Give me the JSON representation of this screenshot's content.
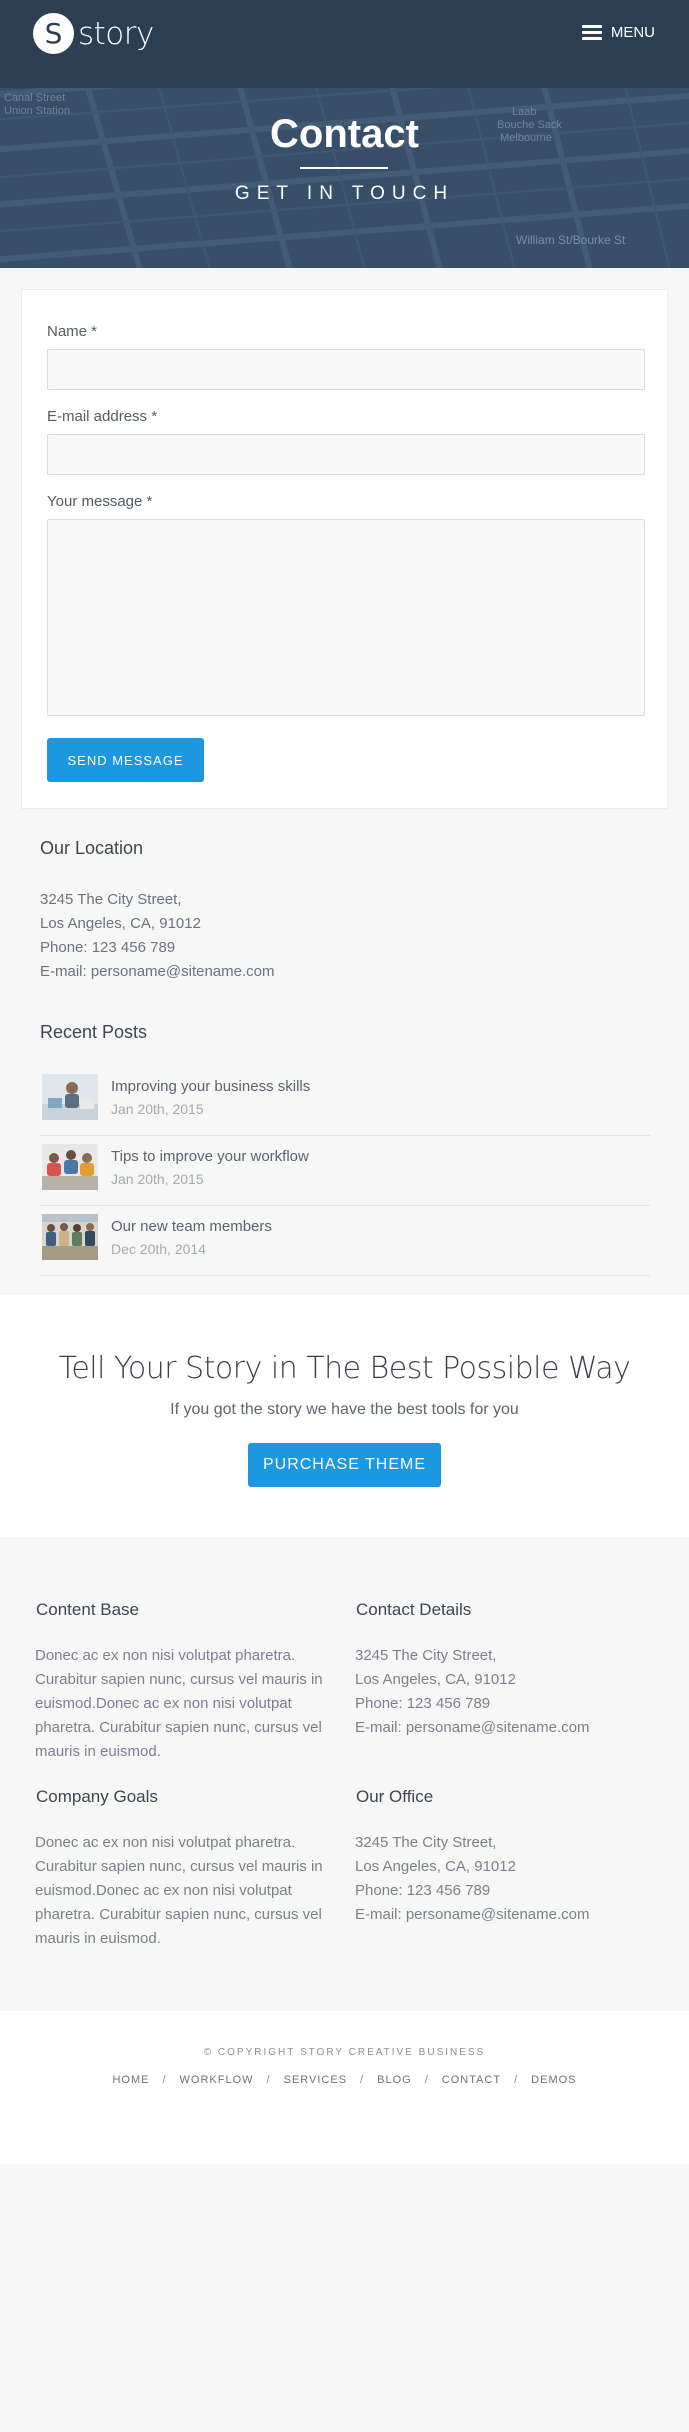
{
  "header": {
    "logo_letter": "S",
    "logo_text": "story",
    "menu_label": "MENU"
  },
  "hero": {
    "title": "Contact",
    "subtitle": "GET IN TOUCH",
    "map_labels": [
      "Canal Street",
      "Union Station",
      "Laab",
      "Bouche Sack",
      "Melbourne",
      "William St/Bourke St"
    ]
  },
  "form": {
    "name_label": "Name *",
    "name_value": "",
    "email_label": "E-mail address *",
    "email_value": "",
    "message_label": "Your message *",
    "message_value": "",
    "submit_label": "SEND MESSAGE"
  },
  "location": {
    "heading": "Our Location",
    "lines": [
      "3245 The City Street,",
      "Los Angeles, CA, 91012",
      "Phone: 123 456 789",
      "E-mail: personame@sitename.com"
    ]
  },
  "recent_posts": {
    "heading": "Recent Posts",
    "items": [
      {
        "title": "Improving your business skills",
        "date": "Jan 20th, 2015"
      },
      {
        "title": "Tips to improve your workflow",
        "date": "Jan 20th, 2015"
      },
      {
        "title": "Our new team members",
        "date": "Dec 20th, 2014"
      }
    ]
  },
  "cta": {
    "title": "Tell Your Story in The Best Possible Way",
    "subtitle": "If you got the story we have the best tools for you",
    "button_label": "PURCHASE THEME"
  },
  "info": {
    "content_base": {
      "heading": "Content Base",
      "lines": [
        "Donec ac ex non nisi volutpat pharetra.",
        "Curabitur sapien nunc, cursus vel mauris in",
        "euismod.Donec ac ex non nisi volutpat",
        "pharetra. Curabitur sapien nunc, cursus vel",
        "mauris in euismod."
      ]
    },
    "contact_details": {
      "heading": "Contact Details",
      "lines": [
        "3245 The City Street,",
        "Los Angeles, CA, 91012",
        "Phone: 123 456 789",
        "E-mail: personame@sitename.com"
      ]
    },
    "company_goals": {
      "heading": "Company Goals",
      "lines": [
        "Donec ac ex non nisi volutpat pharetra.",
        "Curabitur sapien nunc, cursus vel mauris in",
        "euismod.Donec ac ex non nisi volutpat",
        "pharetra. Curabitur sapien nunc, cursus vel",
        "mauris in euismod."
      ]
    },
    "our_office": {
      "heading": "Our Office",
      "lines": [
        "3245 The City Street,",
        "Los Angeles, CA, 91012",
        "Phone: 123 456 789",
        "E-mail: personame@sitename.com"
      ]
    }
  },
  "footer": {
    "copyright": "© COPYRIGHT STORY CREATIVE BUSINESS",
    "nav": [
      "HOME",
      "WORKFLOW",
      "SERVICES",
      "BLOG",
      "CONTACT",
      "DEMOS"
    ],
    "separator": "/"
  },
  "colors": {
    "accent": "#1b98e0",
    "header_bg": "#2c3e52",
    "page_bg": "#f7f7f7"
  }
}
